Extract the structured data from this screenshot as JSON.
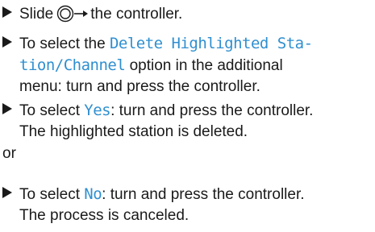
{
  "steps": [
    {
      "icon": "slide-right-controller-icon",
      "text_before": "Slide",
      "text_after": "the controller."
    },
    {
      "line1_prefix": "To select the",
      "line1_option": "Delete Highlighted Sta-",
      "line2_option": "tion/Channel",
      "line2_rest": "option in the additional",
      "line3": "menu: turn and press the controller."
    },
    {
      "line1_prefix": "To select",
      "line1_option": "Yes",
      "line1_rest": ": turn and press the controller.",
      "line2": "The highlighted station is deleted."
    },
    {
      "line1_prefix": "To select",
      "line1_option": "No",
      "line1_rest": ": turn and press the controller.",
      "line2": "The process is canceled."
    }
  ],
  "or_text": "or",
  "colors": {
    "option_text": "#2f8fd0",
    "body_text": "#1a1a1a"
  }
}
